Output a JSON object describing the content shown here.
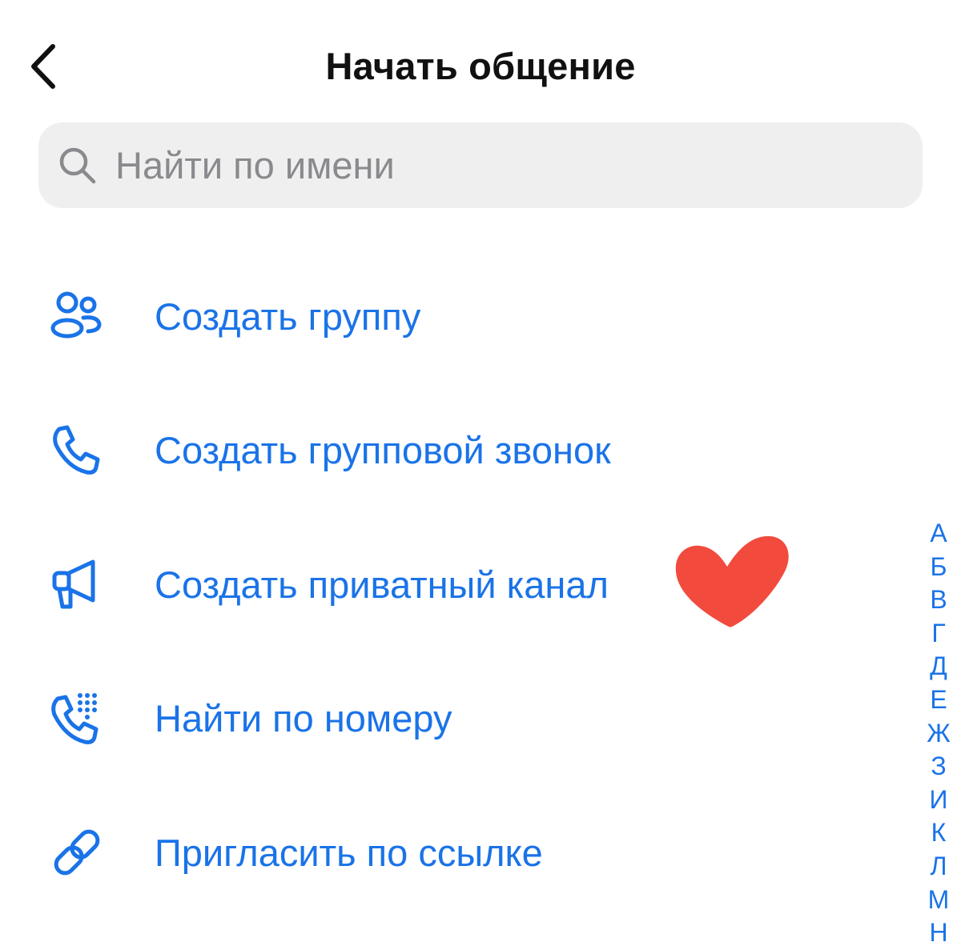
{
  "header": {
    "title": "Начать общение",
    "back_icon": "chevron-left-icon"
  },
  "search": {
    "placeholder": "Найти по имени",
    "value": "",
    "icon": "search-icon"
  },
  "actions": [
    {
      "label": "Создать группу",
      "icon": "group-icon"
    },
    {
      "label": "Создать групповой звонок",
      "icon": "phone-icon"
    },
    {
      "label": "Создать приватный канал",
      "icon": "megaphone-icon"
    },
    {
      "label": "Найти по номеру",
      "icon": "phone-dialpad-icon"
    },
    {
      "label": "Пригласить по ссылке",
      "icon": "link-icon"
    }
  ],
  "alphabet_index": [
    "А",
    "Б",
    "В",
    "Г",
    "Д",
    "Е",
    "Ж",
    "З",
    "И",
    "К",
    "Л",
    "М",
    "Н"
  ],
  "colors": {
    "accent": "#1a73e8",
    "title": "#111111",
    "search_bg": "#efefef",
    "placeholder": "#8a8a8e",
    "heart": "#f24a3d"
  }
}
